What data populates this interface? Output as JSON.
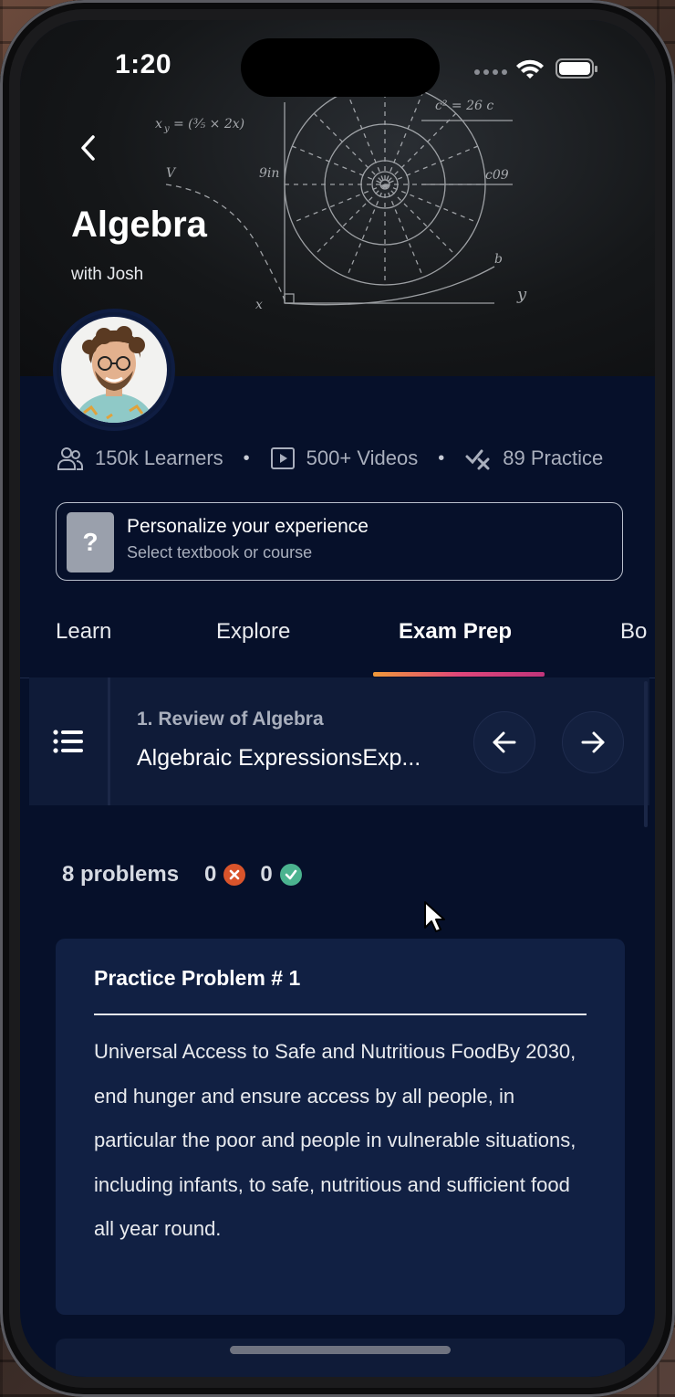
{
  "status_bar": {
    "time": "1:20"
  },
  "header": {
    "title": "Algebra",
    "instructor": "with Josh"
  },
  "stats": [
    {
      "icon": "users-icon",
      "label": "150k Learners"
    },
    {
      "icon": "video-icon",
      "label": "500+ Videos"
    },
    {
      "icon": "practice-icon",
      "label": "89 Practice"
    }
  ],
  "personalize": {
    "icon_text": "?",
    "title": "Personalize your experience",
    "subtitle": "Select textbook or course"
  },
  "tabs": [
    {
      "label": "Learn",
      "active": false
    },
    {
      "label": "Explore",
      "active": false
    },
    {
      "label": "Exam Prep",
      "active": true
    },
    {
      "label": "Bo",
      "active": false
    }
  ],
  "lesson": {
    "chapter": "1. Review of Algebra",
    "title": "Algebraic ExpressionsExp..."
  },
  "progress": {
    "problems_label": "8 problems",
    "wrong_count": "0",
    "correct_count": "0"
  },
  "problem": {
    "title": "Practice Problem # 1",
    "body": "Universal Access to Safe and Nutritious FoodBy 2030, end hunger and ensure access by all people, in particular the poor and people in vulnerable situations, including infants, to safe, nutritious and sufficient food all year round."
  },
  "colors": {
    "background": "#06102a",
    "card": "#112043",
    "wrong": "#d9542b",
    "correct": "#4bb38f",
    "tab_accent": "#e0467a"
  }
}
